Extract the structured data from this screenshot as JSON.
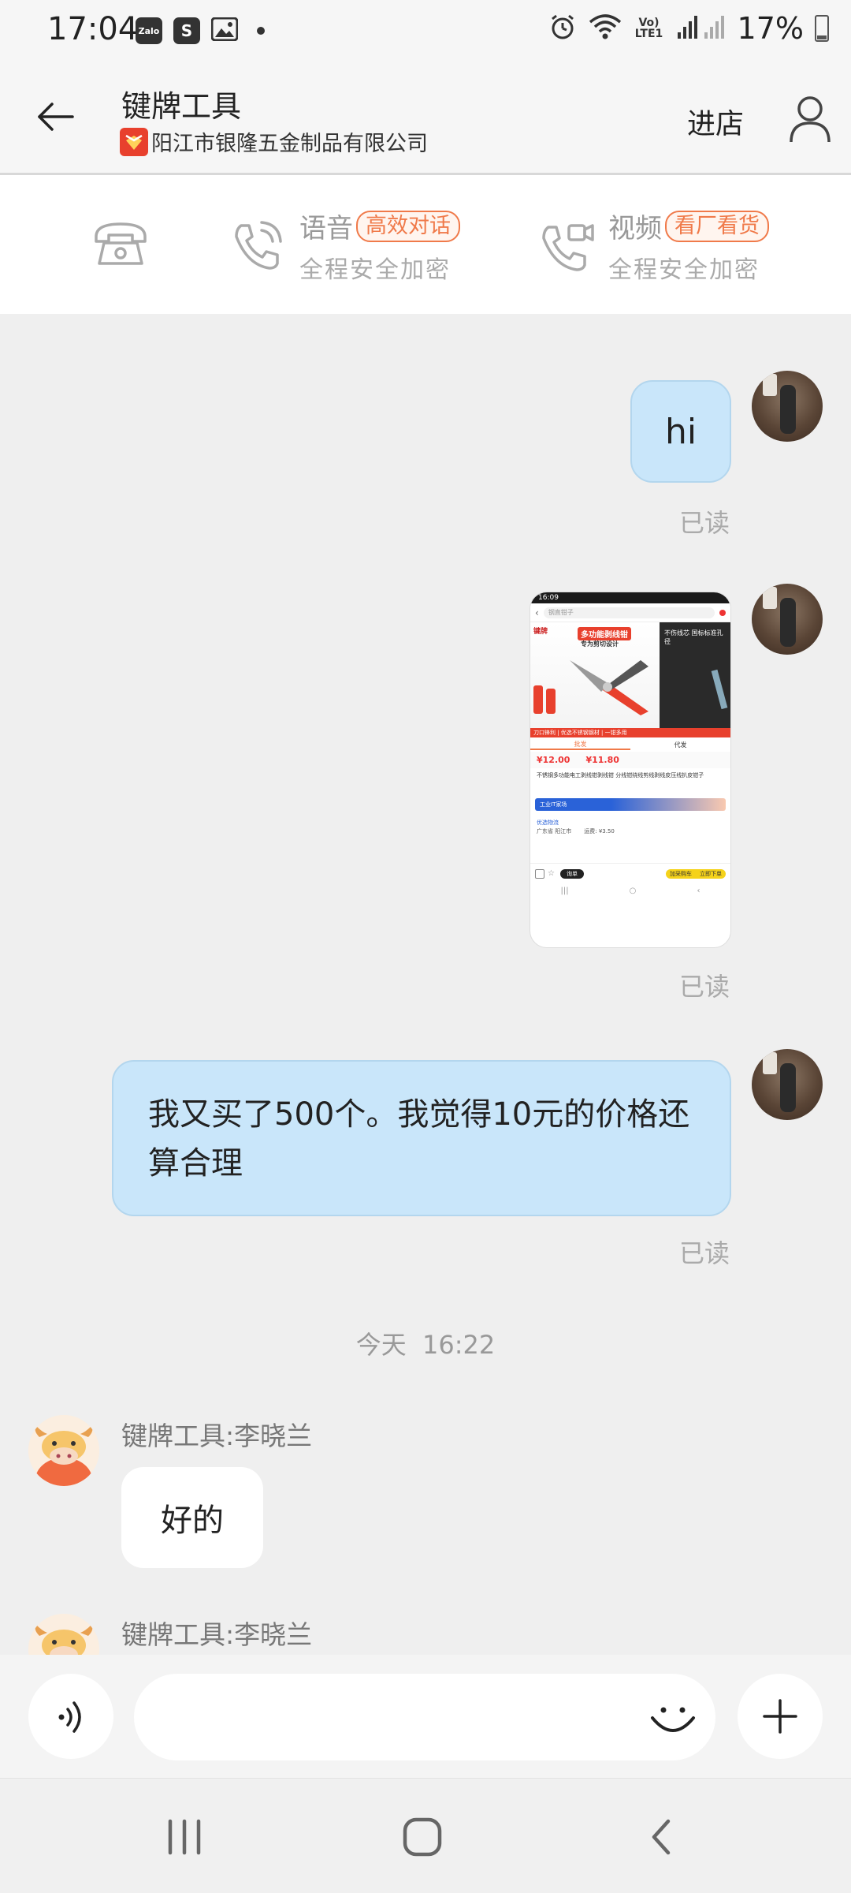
{
  "status_bar": {
    "time": "17:04",
    "apps": [
      "Zalo",
      "S"
    ],
    "network": "Vo) LTE1",
    "battery": "17%"
  },
  "header": {
    "title": "键牌工具",
    "shop_name": "阳江市银隆五金制品有限公司",
    "enter_shop": "进店"
  },
  "call_bar": {
    "voice_label": "语音",
    "voice_tag": "高效对话",
    "voice_sub": "全程安全加密",
    "video_label": "视频",
    "video_tag": "看厂看货",
    "video_sub": "全程安全加密"
  },
  "messages": {
    "msg1_text": "hi",
    "msg1_status": "已读",
    "msg2_status": "已读",
    "msg3_text": "我又买了500个。我觉得10元的价格还算合理",
    "msg3_status": "已读",
    "timestamp": "今天  16:22",
    "reply1_sender": "键牌工具:李晓兰",
    "reply1_text": "好的",
    "reply2_sender": "键牌工具:李晓兰"
  },
  "thumbnail": {
    "time": "16:09",
    "search": "钢直钳子",
    "brand": "键牌",
    "banner_title": "多功能剥线钳",
    "banner_sub": "专为剪切设计",
    "side_title": "不伤线芯 国标标准孔径",
    "strip_text": "刀口锋利 | 优选不锈钢钢材 | 一钳多用",
    "tab_left": "批发",
    "tab_right": "代发",
    "price1": "¥12.00",
    "price2": "¥11.80",
    "product_name": "不锈钢多功能电工剥线钳剥线钳 分线钳绕线剪线剥线皮压线扒皮钳子",
    "factory_bar": "工业IT家场",
    "ship_label": "优选物流",
    "ship_from": "广东省 阳江市",
    "shipping_fee": "运费: ¥3.50",
    "btn_chat": "询单",
    "btn_cart": "加采购车",
    "btn_buy": "立即下单"
  },
  "icons": {
    "back": "arrow-left-icon",
    "user": "user-icon",
    "phone": "phone-icon",
    "voice_call": "voice-call-icon",
    "video_call": "video-call-icon",
    "voice_input": "voice-input-icon",
    "emoji": "emoji-icon",
    "plus": "plus-icon"
  },
  "colors": {
    "self_bubble": "#c9e6fa",
    "accent_orange": "#f07a4a",
    "shop_red": "#e8402d"
  }
}
